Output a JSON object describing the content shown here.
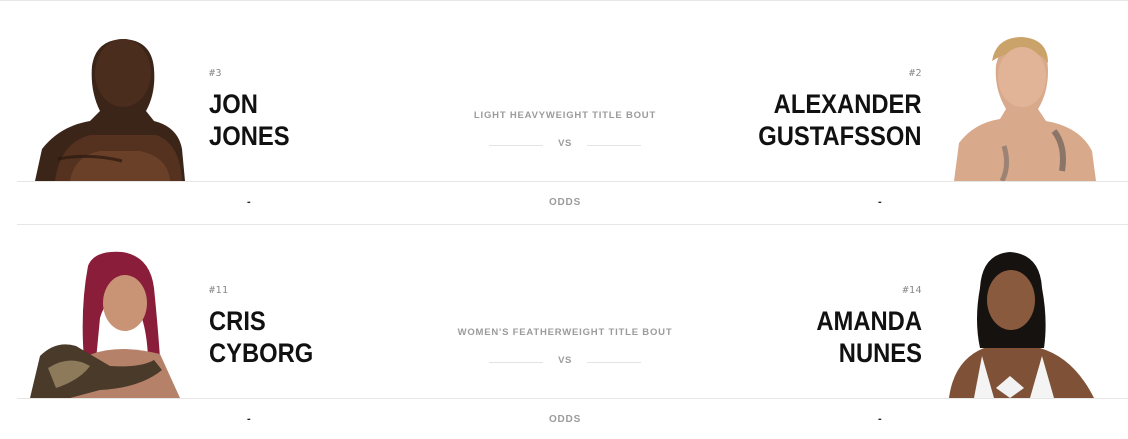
{
  "bouts": [
    {
      "title": "LIGHT HEAVYWEIGHT TITLE BOUT",
      "vs": "VS",
      "odds_label": "ODDS",
      "red": {
        "rank": "#3",
        "first": "JON",
        "last": "JONES",
        "odds": "-"
      },
      "blue": {
        "rank": "#2",
        "first": "ALEXANDER",
        "last": "GUSTAFSSON",
        "odds": "-"
      }
    },
    {
      "title": "WOMEN'S FEATHERWEIGHT TITLE BOUT",
      "vs": "VS",
      "odds_label": "ODDS",
      "red": {
        "rank": "#11",
        "first": "CRIS",
        "last": "CYBORG",
        "odds": "-"
      },
      "blue": {
        "rank": "#14",
        "first": "AMANDA",
        "last": "NUNES",
        "odds": "-"
      }
    }
  ]
}
